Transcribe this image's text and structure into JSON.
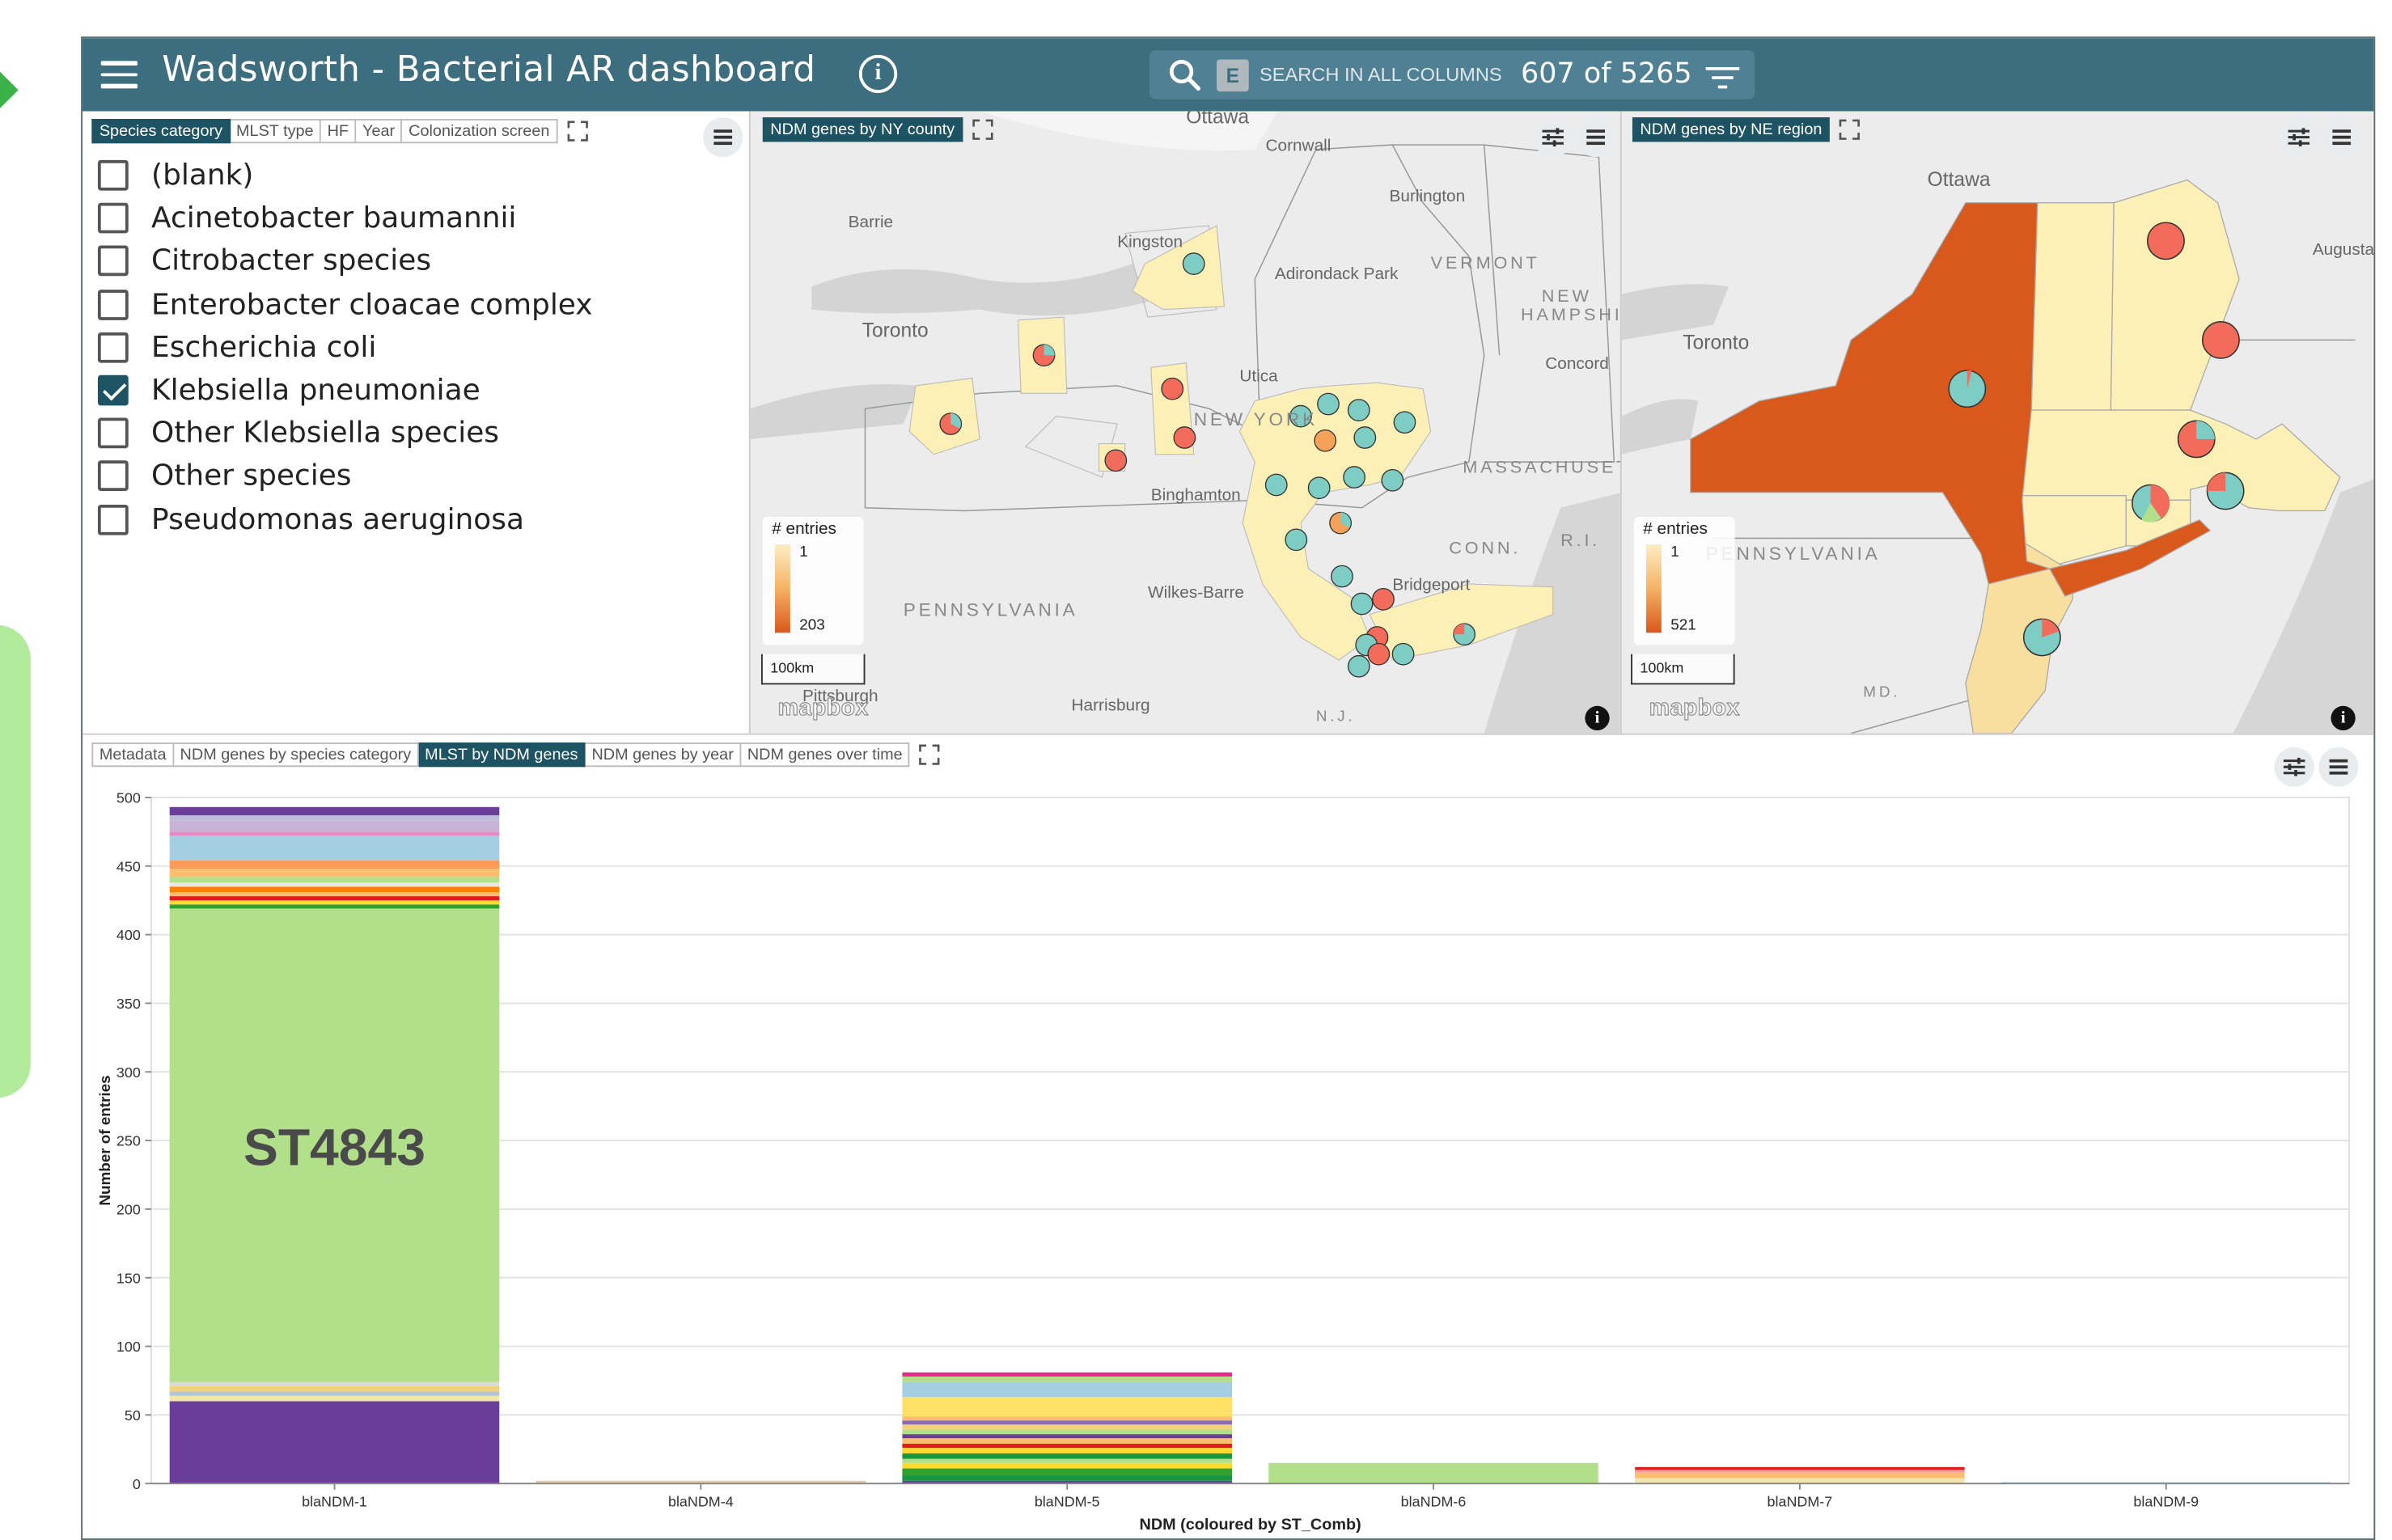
{
  "header": {
    "title": "Wadsworth - Bacterial AR dashboard",
    "search_placeholder": "SEARCH IN ALL COLUMNS",
    "search_badge": "E",
    "record_count": "607 of 5265"
  },
  "species_panel": {
    "tabs": [
      {
        "label": "Species category",
        "active": true
      },
      {
        "label": "MLST type",
        "active": false
      },
      {
        "label": "HF",
        "active": false
      },
      {
        "label": "Year",
        "active": false
      },
      {
        "label": "Colonization screen",
        "active": false
      }
    ],
    "items": [
      {
        "label": "(blank)",
        "checked": false
      },
      {
        "label": "Acinetobacter baumannii",
        "checked": false
      },
      {
        "label": "Citrobacter species",
        "checked": false
      },
      {
        "label": "Enterobacter cloacae complex",
        "checked": false
      },
      {
        "label": "Escherichia coli",
        "checked": false
      },
      {
        "label": "Klebsiella pneumoniae",
        "checked": true
      },
      {
        "label": "Other Klebsiella species",
        "checked": false
      },
      {
        "label": "Other species",
        "checked": false
      },
      {
        "label": "Pseudomonas aeruginosa",
        "checked": false
      }
    ]
  },
  "map_county": {
    "tab": "NDM genes by NY county",
    "legend_title": "# entries",
    "legend_min": "1",
    "legend_max": "203",
    "scale": "100km",
    "attribution": "mapbox",
    "place_labels": [
      "Ottawa",
      "Cornwall",
      "Burlington",
      "Barrie",
      "Kingston",
      "Adirondack Park",
      "VERMONT",
      "NEW HAMPSHIRE",
      "Toronto",
      "Concord",
      "Utica",
      "NEW YORK",
      "MASSACHUSETTS",
      "Binghamton",
      "CONN.",
      "R.I.",
      "PENNSYLVANIA",
      "Bridgeport",
      "Wilkes-Barre",
      "Pittsburgh",
      "Harrisburg",
      "N.J."
    ]
  },
  "map_region": {
    "tab": "NDM genes by NE region",
    "legend_title": "# entries",
    "legend_min": "1",
    "legend_max": "521",
    "scale": "100km",
    "attribution": "mapbox",
    "place_labels": [
      "Ottawa",
      "Augusta",
      "Toronto",
      "PENNSYLVANIA",
      "MD."
    ]
  },
  "bottom_panel": {
    "tabs": [
      {
        "label": "Metadata",
        "active": false
      },
      {
        "label": "NDM genes by species category",
        "active": false
      },
      {
        "label": "MLST by NDM genes",
        "active": true
      },
      {
        "label": "NDM genes by year",
        "active": false
      },
      {
        "label": "NDM genes over time",
        "active": false
      }
    ]
  },
  "colors": {
    "header": "#3c6e80",
    "active_tab": "#1d5363",
    "map_fill_high": "#d9581b",
    "map_fill_low": "#fdf0b6"
  },
  "chart_data": {
    "type": "bar",
    "stacked": true,
    "categories": [
      "blaNDM-1",
      "blaNDM-4",
      "blaNDM-5",
      "blaNDM-6",
      "blaNDM-7",
      "blaNDM-9"
    ],
    "xlabel": "NDM (coloured by ST_Comb)",
    "ylabel": "Number of entries",
    "ylim": [
      0,
      500
    ],
    "yticks": [
      0,
      50,
      100,
      150,
      200,
      250,
      300,
      350,
      400,
      450,
      500
    ],
    "grid": true,
    "annotation": "ST4843",
    "totals": [
      495,
      2,
      81,
      15,
      12,
      1
    ],
    "segments": [
      [
        {
          "value": 60,
          "color": "#6a3d9a"
        },
        {
          "value": 4,
          "color": "#f0e6a8"
        },
        {
          "value": 3,
          "color": "#b0c4de"
        },
        {
          "value": 4,
          "color": "#f2d27a"
        },
        {
          "value": 3,
          "color": "#d9d9d9"
        },
        {
          "value": 345,
          "color": "#b2df8a"
        },
        {
          "value": 3,
          "color": "#33a02c"
        },
        {
          "value": 3,
          "color": "#ffd92f"
        },
        {
          "value": 3,
          "color": "#e31a1c"
        },
        {
          "value": 3,
          "color": "#fdbf6f"
        },
        {
          "value": 4,
          "color": "#ff7f00"
        },
        {
          "value": 3,
          "color": "#e7e7e7"
        },
        {
          "value": 4,
          "color": "#b2df8a"
        },
        {
          "value": 6,
          "color": "#fdbf6f"
        },
        {
          "value": 6,
          "color": "#fb9a59"
        },
        {
          "value": 18,
          "color": "#a6cee3"
        },
        {
          "value": 3,
          "color": "#e78ac3"
        },
        {
          "value": 8,
          "color": "#cab2d6"
        },
        {
          "value": 4,
          "color": "#bebada"
        },
        {
          "value": 6,
          "color": "#6a3d9a"
        }
      ],
      [
        {
          "value": 2,
          "color": "#e6c9a8"
        }
      ],
      [
        {
          "value": 2,
          "color": "#6a3d9a"
        },
        {
          "value": 4,
          "color": "#1a9641"
        },
        {
          "value": 5,
          "color": "#33a02c"
        },
        {
          "value": 4,
          "color": "#ffd92f"
        },
        {
          "value": 3,
          "color": "#b2df8a"
        },
        {
          "value": 4,
          "color": "#1a9641"
        },
        {
          "value": 4,
          "color": "#ffd92f"
        },
        {
          "value": 3,
          "color": "#e31a1c"
        },
        {
          "value": 4,
          "color": "#fdbf6f"
        },
        {
          "value": 3,
          "color": "#6a3d9a"
        },
        {
          "value": 3,
          "color": "#b2df8a"
        },
        {
          "value": 4,
          "color": "#f2d27a"
        },
        {
          "value": 3,
          "color": "#8c6bb1"
        },
        {
          "value": 3,
          "color": "#fdbf6f"
        },
        {
          "value": 14,
          "color": "#ffe066"
        },
        {
          "value": 11,
          "color": "#a6cee3"
        },
        {
          "value": 4,
          "color": "#b2df8a"
        },
        {
          "value": 3,
          "color": "#e7298a"
        }
      ],
      [
        {
          "value": 15,
          "color": "#b2df8a"
        }
      ],
      [
        {
          "value": 4,
          "color": "#f2e6b0"
        },
        {
          "value": 4,
          "color": "#fdbf6f"
        },
        {
          "value": 2,
          "color": "#fb9a99"
        },
        {
          "value": 2,
          "color": "#e31a1c"
        }
      ],
      [
        {
          "value": 1,
          "color": "#a6cee3"
        }
      ]
    ]
  }
}
